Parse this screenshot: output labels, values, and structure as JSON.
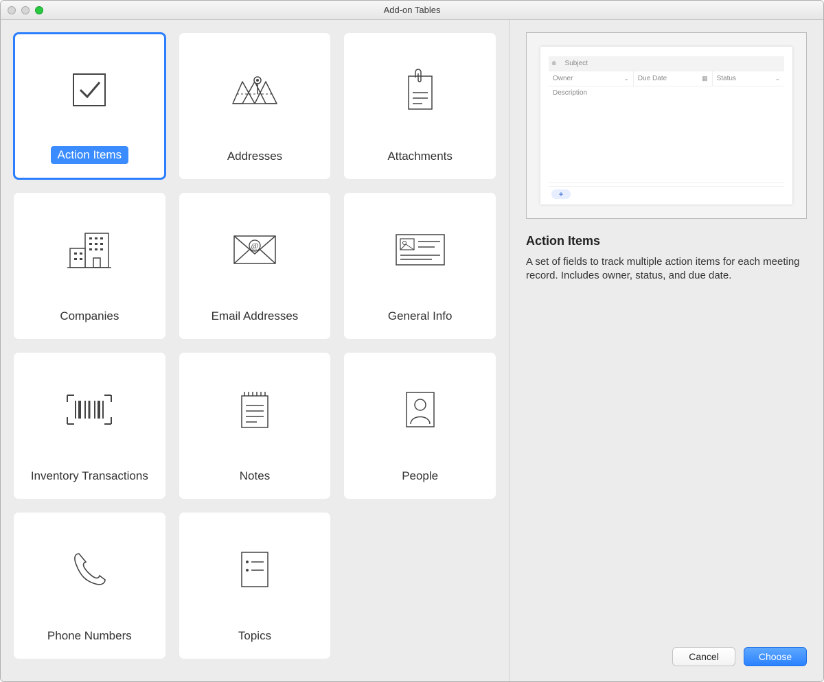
{
  "window": {
    "title": "Add-on Tables"
  },
  "tiles": [
    {
      "id": "action-items",
      "label": "Action Items",
      "selected": true
    },
    {
      "id": "addresses",
      "label": "Addresses"
    },
    {
      "id": "attachments",
      "label": "Attachments"
    },
    {
      "id": "companies",
      "label": "Companies"
    },
    {
      "id": "email-addresses",
      "label": "Email Addresses"
    },
    {
      "id": "general-info",
      "label": "General Info"
    },
    {
      "id": "inventory-transactions",
      "label": "Inventory Transactions"
    },
    {
      "id": "notes",
      "label": "Notes"
    },
    {
      "id": "people",
      "label": "People"
    },
    {
      "id": "phone-numbers",
      "label": "Phone Numbers"
    },
    {
      "id": "topics",
      "label": "Topics"
    }
  ],
  "preview": {
    "fields": {
      "subject": "Subject",
      "owner": "Owner",
      "due_date": "Due Date",
      "status": "Status",
      "description": "Description"
    }
  },
  "detail": {
    "title": "Action Items",
    "description": "A set of fields to track multiple action items for each meeting record. Includes owner, status, and due date."
  },
  "buttons": {
    "cancel": "Cancel",
    "choose": "Choose"
  }
}
